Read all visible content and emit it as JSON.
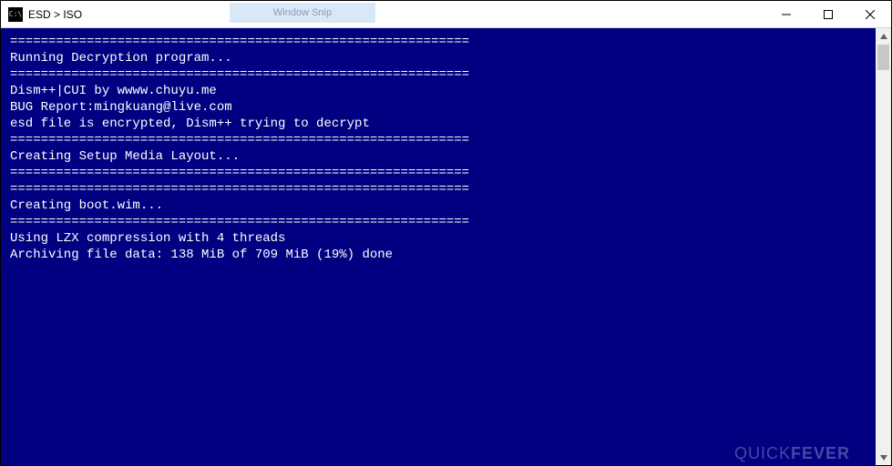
{
  "window": {
    "title": "ESD > ISO",
    "ghost_label": "Window Snip"
  },
  "terminal": {
    "lines": {
      "l00": "",
      "l01": "",
      "l02": "============================================================",
      "l03": "Running Decryption program...",
      "l04": "============================================================",
      "l05": "",
      "l06": "Dism++|CUI by wwww.chuyu.me",
      "l07": "BUG Report:mingkuang@live.com",
      "l08": "",
      "l09": "",
      "l10": "esd file is encrypted, Dism++ trying to decrypt",
      "l11": "============================================================",
      "l12": "Creating Setup Media Layout...",
      "l13": "============================================================",
      "l14": "",
      "l15": "",
      "l16": "",
      "l17": "============================================================",
      "l18": "Creating boot.wim...",
      "l19": "============================================================",
      "l20": "",
      "l21": "Using LZX compression with 4 threads",
      "l22": "Archiving file data: 138 MiB of 709 MiB (19%) done"
    }
  },
  "watermark": {
    "part1": "QUICK",
    "part2": "FEVER"
  },
  "colors": {
    "terminal_bg": "#000080",
    "terminal_fg": "#ffffff"
  }
}
